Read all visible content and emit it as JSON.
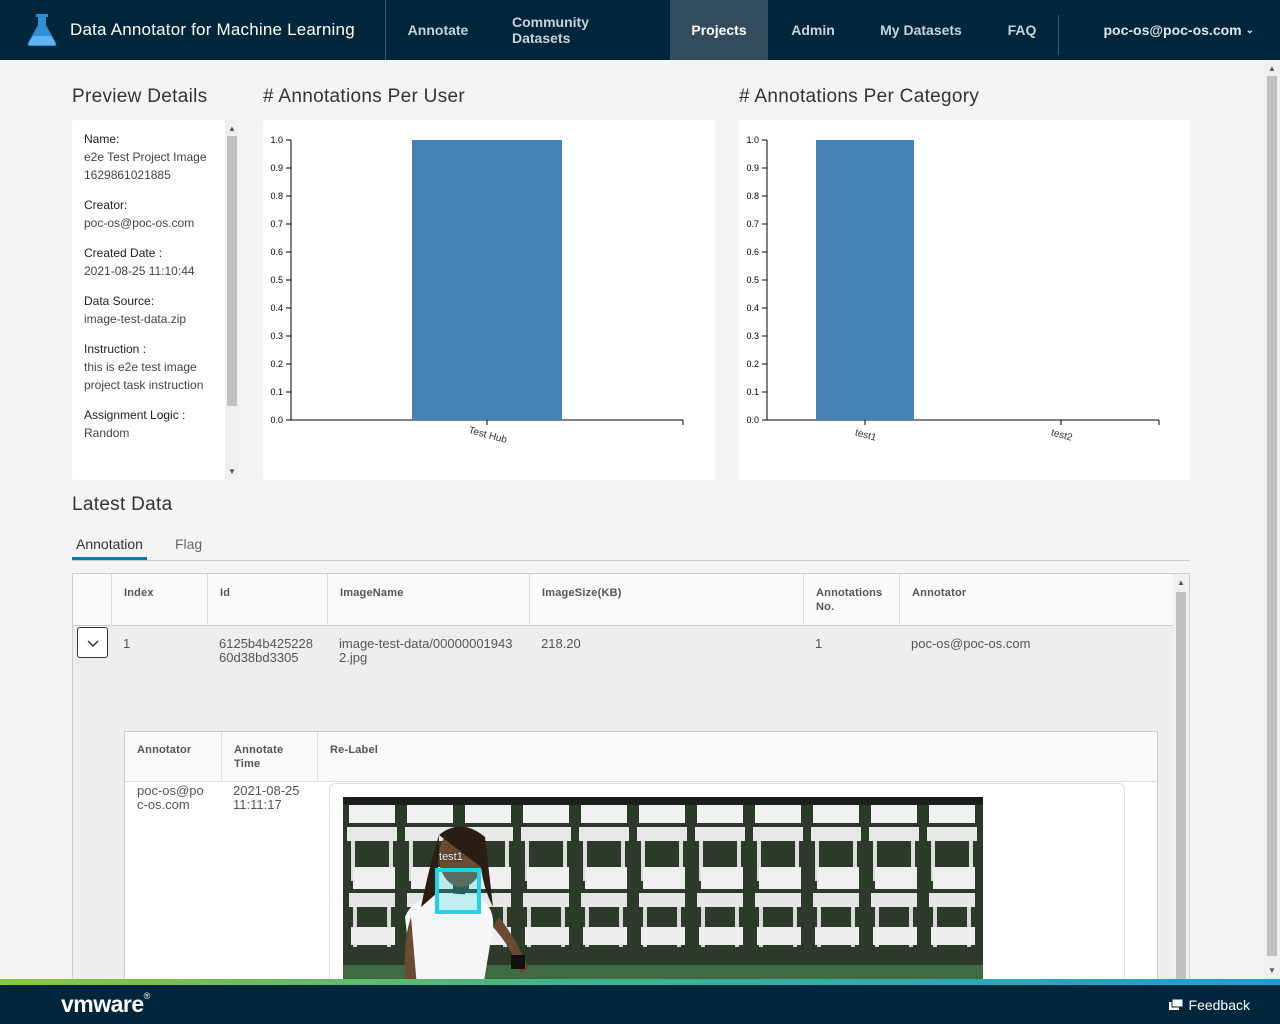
{
  "header": {
    "app_title": "Data Annotator for Machine Learning",
    "nav": [
      {
        "label": "Annotate"
      },
      {
        "label": "Community Datasets"
      },
      {
        "label": "Projects"
      },
      {
        "label": "Admin"
      },
      {
        "label": "My Datasets"
      },
      {
        "label": "FAQ"
      }
    ],
    "active_nav": "Projects",
    "user": "poc-os@poc-os.com"
  },
  "preview": {
    "title": "Preview Details",
    "fields": [
      {
        "label": "Name:",
        "value": "e2e Test Project Image 1629861021885"
      },
      {
        "label": "Creator:",
        "value": "poc-os@poc-os.com"
      },
      {
        "label": "Created Date :",
        "value": "2021-08-25 11:10:44"
      },
      {
        "label": "Data Source:",
        "value": "image-test-data.zip"
      },
      {
        "label": "Instruction :",
        "value": "this is e2e test image project task instruction"
      },
      {
        "label": "Assignment Logic :",
        "value": "Random"
      }
    ]
  },
  "chart_titles": {
    "per_user": "# Annotations Per User",
    "per_category": "# Annotations Per Category"
  },
  "chart_data": [
    {
      "type": "bar",
      "title": "# Annotations Per User",
      "categories": [
        "Test Hub"
      ],
      "values": [
        1.0
      ],
      "ylim": [
        0,
        1.0
      ],
      "yticks": [
        "0.0",
        "0.1",
        "0.2",
        "0.3",
        "0.4",
        "0.5",
        "0.6",
        "0.7",
        "0.8",
        "0.9",
        "1.0"
      ],
      "color": "#4682b4"
    },
    {
      "type": "bar",
      "title": "# Annotations Per Category",
      "categories": [
        "test1",
        "test2"
      ],
      "values": [
        1.0,
        0
      ],
      "ylim": [
        0,
        1.0
      ],
      "yticks": [
        "0.0",
        "0.1",
        "0.2",
        "0.3",
        "0.4",
        "0.5",
        "0.6",
        "0.7",
        "0.8",
        "0.9",
        "1.0"
      ],
      "color": "#4682b4"
    }
  ],
  "latest": {
    "title": "Latest Data",
    "tabs": [
      {
        "label": "Annotation"
      },
      {
        "label": "Flag"
      }
    ],
    "columns": {
      "index": "Index",
      "id": "Id",
      "image_name": "ImageName",
      "image_size": "ImageSize(KB)",
      "annotations_no": "Annotations No.",
      "annotator": "Annotator"
    },
    "row": {
      "index": "1",
      "id": "6125b4b425228 60d38bd3305",
      "image_name": "image-test-data/00000001943 2.jpg",
      "image_size": "218.20",
      "annotations_no": "1",
      "annotator": "poc-os@poc-os.com"
    },
    "detail": {
      "columns": {
        "annotator": "Annotator",
        "annotate_time": "Annotate Time",
        "relabel": "Re-Label"
      },
      "annotator": "poc-os@po c-os.com",
      "annotate_time": "2021-08-25 11:11:17",
      "box_label": "test1",
      "box_color": "#1fd3e8"
    }
  },
  "footer": {
    "logo": "vmware",
    "feedback": "Feedback"
  }
}
